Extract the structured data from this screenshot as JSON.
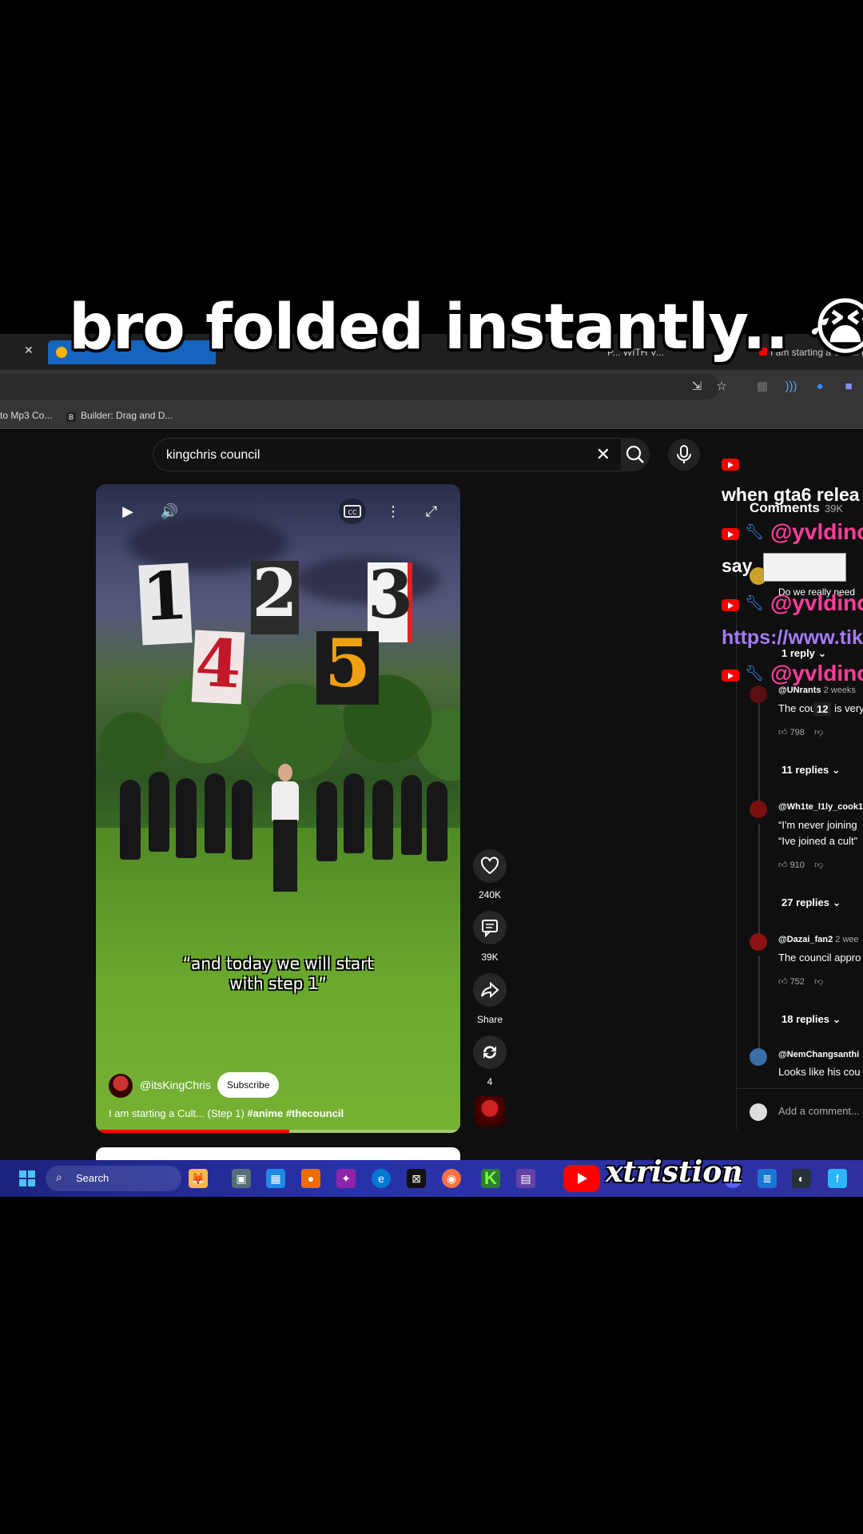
{
  "overlay": {
    "caption": "bro folded instantly.. 😭💔"
  },
  "browser": {
    "tabs": [
      {
        "label": ""
      },
      {
        "label": "P... WITH V..."
      },
      {
        "label": "I am starting a Cult... (S"
      }
    ],
    "bookmarks": [
      {
        "label": "to Mp3 Co..."
      },
      {
        "label": "Builder: Drag and D..."
      }
    ]
  },
  "search": {
    "query": "kingchris council"
  },
  "video": {
    "numbers": [
      "1",
      "2",
      "3",
      "4",
      "5"
    ],
    "subtitle": "“and today we will start\nwith step 1”",
    "channel": "@itsKingChris",
    "subscribe_label": "Subscribe",
    "title_plain": "I am starting a Cult... (Step 1) ",
    "title_tags": "#anime #thecouncil",
    "progress_fraction": 0.53
  },
  "actions": {
    "likes": "240K",
    "comments": "39K",
    "share": "Share",
    "remix": "4"
  },
  "comments": {
    "header": "Comments",
    "count": "39K",
    "items": [
      {
        "text": "Do we really need"
      },
      {
        "replies": "1 reply"
      },
      {
        "author": "@UNrants",
        "time": "2 weeks",
        "text": "The council is very",
        "likes": "798",
        "replies": "11 replies"
      },
      {
        "author": "@Wh1te_l1ly_cook1",
        "text1": "“I'm never joining",
        "text2": "“Ive joined a cult”",
        "likes": "910",
        "replies": "27 replies"
      },
      {
        "author": "@Dazai_fan2",
        "time": "2 wee",
        "text": "The council appro",
        "likes": "752",
        "replies": "18 replies"
      },
      {
        "author": "@NemChangsanthi",
        "text": "Looks like his cou"
      }
    ],
    "add_placeholder": "Add a comment..."
  },
  "chat": {
    "line1": "when gta6 relea",
    "user": "@yvldino",
    "line2": "say",
    "line3": "https://www.tik",
    "number": "12"
  },
  "taskbar": {
    "search_label": "Search",
    "watermark": "xtristion"
  },
  "colors": {
    "accent_red": "#ff0000",
    "tab_active": "#1565c0",
    "chat_pink": "#ff3d9a",
    "chat_link": "#a47bff",
    "taskbar": "#2832a8"
  }
}
